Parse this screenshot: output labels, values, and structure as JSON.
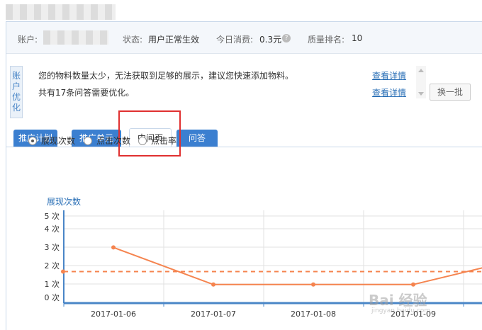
{
  "info": {
    "account_label": "账户:",
    "status_label": "状态:",
    "status_value": "用户正常生效",
    "spend_label": "今日消费:",
    "spend_value": "0.3元",
    "rank_label": "质量排名:",
    "rank_value": "10"
  },
  "optimization": {
    "title": "账户优化",
    "messages": [
      {
        "text": "您的物料数量太少，无法获取到足够的展示，建议您快速添加物料。",
        "link": "查看详情"
      },
      {
        "text": "共有17条问答需要优化。",
        "link": "查看详情"
      }
    ],
    "swap_label": "换一批"
  },
  "tabs": [
    {
      "label": "推广计划"
    },
    {
      "label": "推广单元"
    },
    {
      "label": "中间页"
    },
    {
      "label": "问答"
    }
  ],
  "metrics": [
    {
      "label": "展现次数",
      "selected": true
    },
    {
      "label": "点击次数",
      "selected": false
    },
    {
      "label": "点击率",
      "selected": false
    }
  ],
  "chart_data": {
    "type": "line",
    "ylabel": "展现次数",
    "y_ticks": [
      "0 次",
      "1 次",
      "2 次",
      "3 次",
      "4 次",
      "5 次"
    ],
    "ylim": [
      0,
      5
    ],
    "categories": [
      "2017-01-06",
      "2017-01-07",
      "2017-01-08",
      "2017-01-09"
    ],
    "series": [
      {
        "values": [
          3,
          1,
          1,
          1,
          2.3
        ],
        "color": "#f5844f"
      }
    ],
    "average": 1.7,
    "average_color": "#f5844f",
    "grid": true
  },
  "watermark": {
    "text": "Bai 经验",
    "sub": "jingyan.baidu.com"
  }
}
